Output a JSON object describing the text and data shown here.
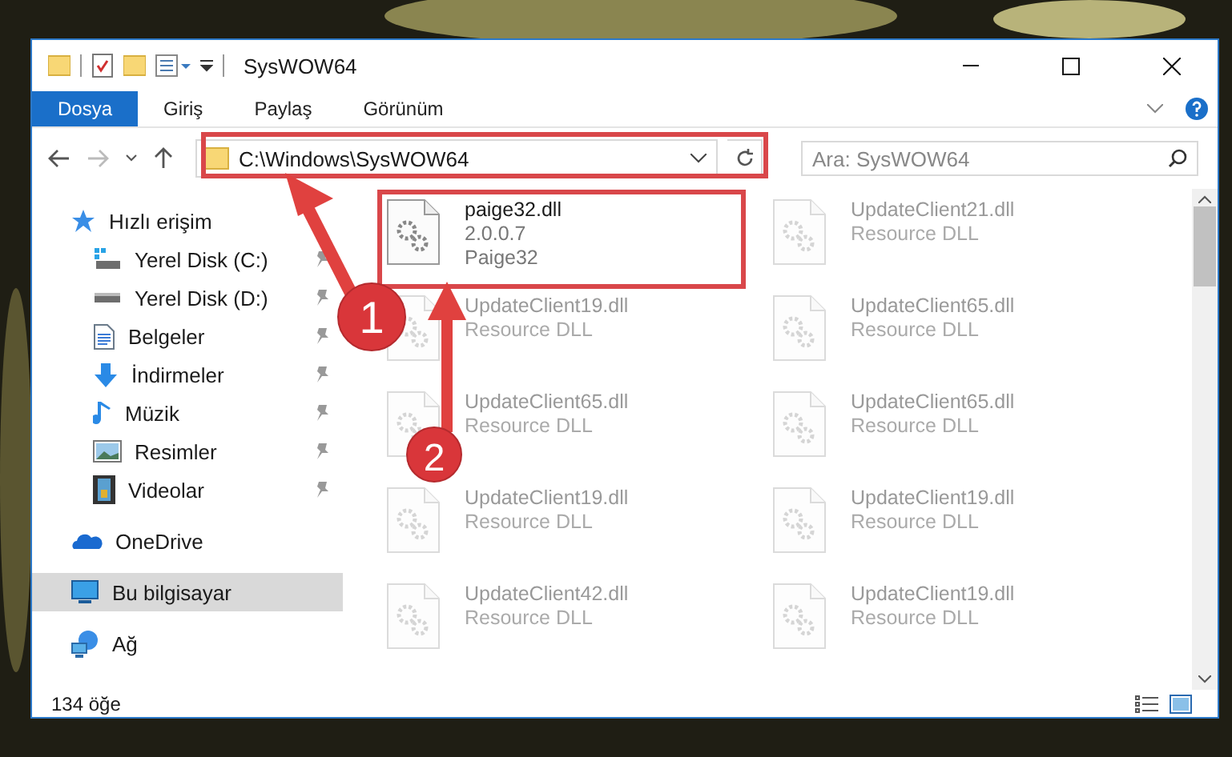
{
  "window": {
    "title": "SysWOW64"
  },
  "ribbon_tabs": [
    {
      "label": "Dosya",
      "selected": true
    },
    {
      "label": "Giriş",
      "selected": false
    },
    {
      "label": "Paylaş",
      "selected": false
    },
    {
      "label": "Görünüm",
      "selected": false
    }
  ],
  "address_bar": {
    "path": "C:\\Windows\\SysWOW64"
  },
  "search": {
    "placeholder": "Ara: SysWOW64"
  },
  "sidebar": {
    "items": [
      {
        "label": "Hızlı erişim",
        "kind": "star",
        "selected": false,
        "children": [
          {
            "label": "Yerel Disk (C:)",
            "kind": "system-drive",
            "pinned": true,
            "selected": false
          },
          {
            "label": "Yerel Disk (D:)",
            "kind": "drive",
            "pinned": true,
            "selected": false
          },
          {
            "label": "Belgeler",
            "kind": "document",
            "pinned": true,
            "selected": false
          },
          {
            "label": "İndirmeler",
            "kind": "download",
            "pinned": true,
            "selected": false
          },
          {
            "label": "Müzik",
            "kind": "music",
            "pinned": true,
            "selected": false
          },
          {
            "label": "Resimler",
            "kind": "pictures",
            "pinned": true,
            "selected": false
          },
          {
            "label": "Videolar",
            "kind": "video",
            "pinned": true,
            "selected": false
          }
        ]
      },
      {
        "label": "OneDrive",
        "kind": "cloud",
        "selected": false
      },
      {
        "label": "Bu bilgisayar",
        "kind": "computer",
        "selected": true
      },
      {
        "label": "Ağ",
        "kind": "network",
        "selected": false
      }
    ]
  },
  "files": [
    {
      "name": "paige32.dll",
      "details": [
        "2.0.0.7",
        "Paige32"
      ],
      "dimmed": false
    },
    {
      "name": "UpdateClient21.dll",
      "details": [
        "Resource DLL"
      ],
      "dimmed": true
    },
    {
      "name": "UpdateClient19.dll",
      "details": [
        "Resource DLL"
      ],
      "dimmed": true
    },
    {
      "name": "UpdateClient65.dll",
      "details": [
        "Resource DLL"
      ],
      "dimmed": true
    },
    {
      "name": "UpdateClient65.dll",
      "details": [
        "Resource DLL"
      ],
      "dimmed": true
    },
    {
      "name": "UpdateClient65.dll",
      "details": [
        "Resource DLL"
      ],
      "dimmed": true
    },
    {
      "name": "UpdateClient19.dll",
      "details": [
        "Resource DLL"
      ],
      "dimmed": true
    },
    {
      "name": "UpdateClient19.dll",
      "details": [
        "Resource DLL"
      ],
      "dimmed": true
    },
    {
      "name": "UpdateClient42.dll",
      "details": [
        "Resource DLL"
      ],
      "dimmed": true
    },
    {
      "name": "UpdateClient19.dll",
      "details": [
        "Resource DLL"
      ],
      "dimmed": true
    }
  ],
  "status_bar": {
    "item_count": "134 öğe"
  },
  "callouts": [
    {
      "number": "1"
    },
    {
      "number": "2"
    }
  ]
}
